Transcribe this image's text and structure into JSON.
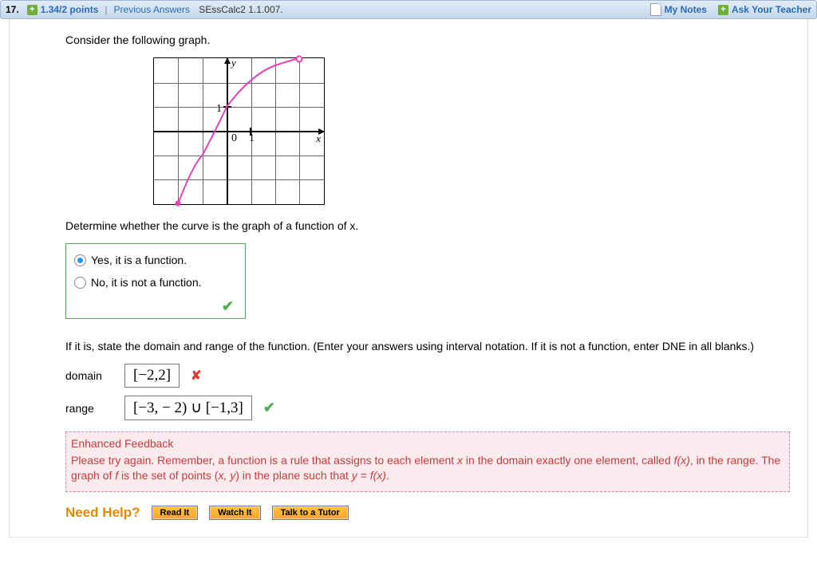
{
  "header": {
    "number": "17.",
    "points": "1.34/2 points",
    "previous": "Previous Answers",
    "source": "SEssCalc2 1.1.007.",
    "notes": "My Notes",
    "ask": "Ask Your Teacher"
  },
  "intro": "Consider the following graph.",
  "graph": {
    "y_label": "y",
    "x_label": "x",
    "origin": "0",
    "one": "1",
    "oneY": "1"
  },
  "q1_prompt": "Determine whether the curve is the graph of a function of x.",
  "options": {
    "yes": "Yes, it is a function.",
    "no": "No, it is not a function."
  },
  "q2_prompt": "If it is, state the domain and range of the function. (Enter your answers using interval notation. If it is not a function, enter DNE in all blanks.)",
  "labels": {
    "domain": "domain",
    "range": "range"
  },
  "answers": {
    "domain": "[−2,2]",
    "range": "[−3, − 2) ∪ [−1,3]"
  },
  "feedback": {
    "title": "Enhanced Feedback",
    "body_1": "Please try again. Remember, a function is a rule that assigns to each element ",
    "body_x": "x",
    "body_2": " in the domain exactly one element, called ",
    "body_fx1": "f(x)",
    "body_3": ",  in the range. The graph of ",
    "body_f": "f",
    "body_4": " is the set of points  (",
    "body_xy": "x, y",
    "body_5": ")  in the plane such that  ",
    "body_eq": "y = f(x)",
    "body_6": "."
  },
  "help": {
    "label": "Need Help?",
    "read": "Read It",
    "watch": "Watch It",
    "tutor": "Talk to a Tutor"
  },
  "chart_data": {
    "type": "line",
    "title": "",
    "xlabel": "x",
    "ylabel": "y",
    "xlim": [
      -3,
      4
    ],
    "ylim": [
      -3,
      3
    ],
    "grid": true,
    "series": [
      {
        "name": "curve",
        "x": [
          -2,
          -1,
          0,
          1,
          2,
          3
        ],
        "y": [
          -3,
          -1,
          1,
          2,
          2.7,
          3
        ],
        "point_style": {
          "start": "closed",
          "end": "open"
        }
      }
    ]
  }
}
